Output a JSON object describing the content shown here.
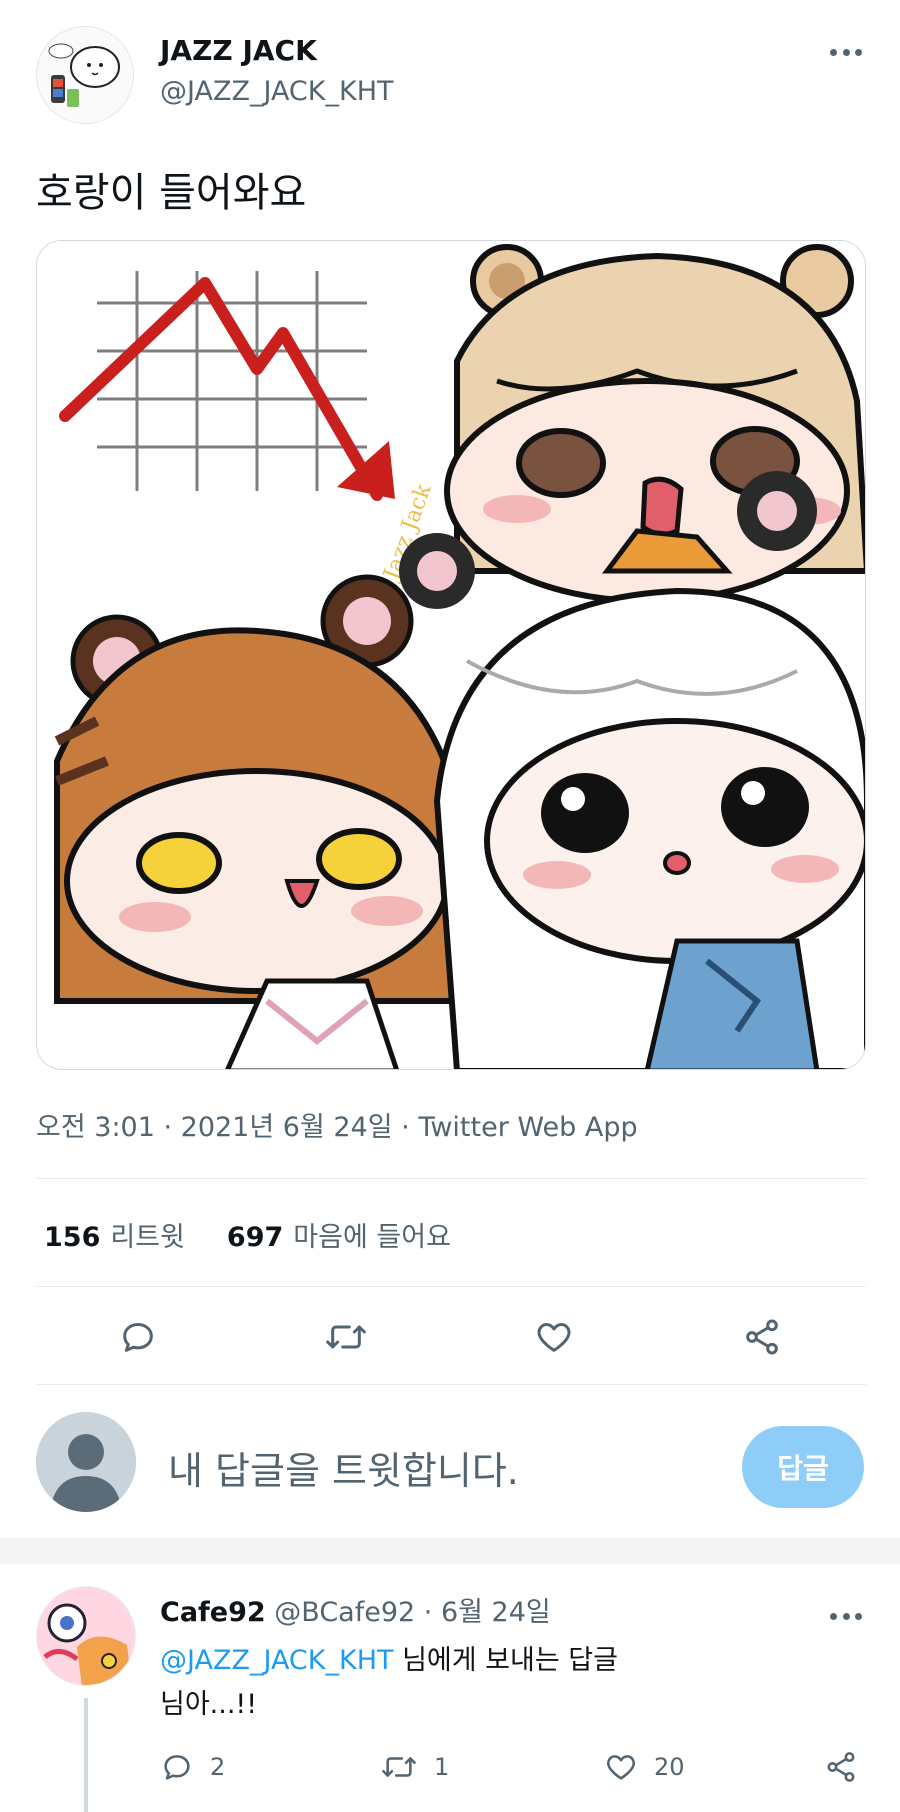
{
  "tweet": {
    "author_name": "JAZZ JACK",
    "author_handle": "@JAZZ_JACK_KHT",
    "text": "호랑이 들어와요",
    "meta": "오전 3:01 · 2021년 6월 24일 · Twitter Web App",
    "stats": {
      "retweets_count": "156",
      "retweets_label": "리트윗",
      "likes_count": "697",
      "likes_label": "마음에 들어요"
    },
    "media_signature": "Jazz Jack"
  },
  "compose": {
    "placeholder": "내 답글을 트윗합니다.",
    "reply_button": "답글"
  },
  "reply": {
    "name": "Cafe92",
    "handle": "@BCafe92",
    "date": "· 6월 24일",
    "replying_mention": "@JAZZ_JACK_KHT",
    "replying_suffix": " 님에게 보내는 답글",
    "text": "님아...!!",
    "reply_count": "2",
    "retweet_count": "1",
    "like_count": "20"
  },
  "icons": {
    "more": "more-horizontal-icon",
    "reply": "comment-bubble-icon",
    "retweet": "retweet-arrows-icon",
    "like": "heart-icon",
    "share": "share-icon"
  },
  "colors": {
    "accent": "#1d9bf0",
    "reply_button_disabled": "#8ecdf8",
    "secondary_text": "#536471"
  }
}
